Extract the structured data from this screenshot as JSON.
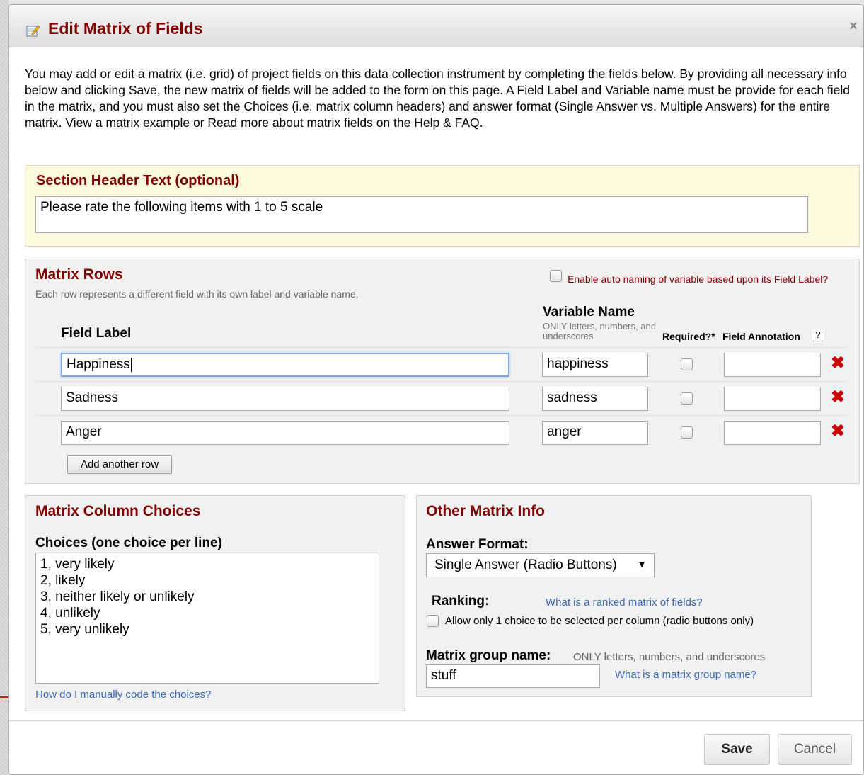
{
  "dialog": {
    "title": "Edit Matrix of Fields",
    "close_symbol": "×",
    "intro_text": "You may add or edit a matrix (i.e. grid) of project fields on this data collection instrument by completing the fields below. By providing all necessary info below and clicking Save, the new matrix of fields will be added to the form on this page. A Field Label and Variable name must be provide for each field in the matrix, and you must also set the Choices (i.e. matrix column headers) and answer format (Single Answer vs. Multiple Answers) for the entire matrix. ",
    "intro_link1": "View a matrix example",
    "intro_or": " or ",
    "intro_link2": "Read more about matrix fields on the Help & FAQ."
  },
  "section_header": {
    "label": "Section Header Text (optional)",
    "value": "Please rate the following items with 1 to 5 scale"
  },
  "matrix_rows": {
    "title": "Matrix Rows",
    "subtitle": "Each row represents a different field with its own label and variable name.",
    "auto_naming_label": "Enable auto naming of variable based upon its Field Label?",
    "col_field_label": "Field Label",
    "col_variable_name": "Variable Name",
    "col_variable_hint": "ONLY letters, numbers, and underscores",
    "col_required": "Required?*",
    "col_annotation": "Field Annotation",
    "help_symbol": "?",
    "delete_symbol": "✖",
    "rows": [
      {
        "field_label": "Happiness",
        "variable_name": "happiness",
        "annotation": ""
      },
      {
        "field_label": "Sadness",
        "variable_name": "sadness",
        "annotation": ""
      },
      {
        "field_label": "Anger",
        "variable_name": "anger",
        "annotation": ""
      }
    ],
    "add_row_label": "Add another row"
  },
  "column_choices": {
    "title": "Matrix Column Choices",
    "subtitle": "Choices (one choice per line)",
    "choices": [
      "1, very likely",
      "2, likely",
      "3, neither likely or unlikely",
      "4, unlikely",
      "5, very unlikely"
    ],
    "help_link": "How do I manually code the choices?"
  },
  "other_info": {
    "title": "Other Matrix Info",
    "answer_format_label": "Answer Format:",
    "answer_format_value": "Single Answer (Radio Buttons)",
    "dropdown_arrow": "▼",
    "ranking_label": "Ranking:",
    "ranking_link": "What is a ranked matrix of fields?",
    "ranking_checkbox_label": "Allow only 1 choice to be selected per column (radio buttons only)",
    "group_name_label": "Matrix group name:",
    "group_name_hint": "ONLY letters, numbers, and underscores",
    "group_name_value": "stuff",
    "group_name_link": "What is a matrix group name?"
  },
  "footer": {
    "save_label": "Save",
    "cancel_label": "Cancel"
  },
  "colors": {
    "header_red": "#800000",
    "link_blue": "#3a6ab5",
    "delete_red": "#cc0000",
    "section_header_bg": "#fcfbe0"
  }
}
